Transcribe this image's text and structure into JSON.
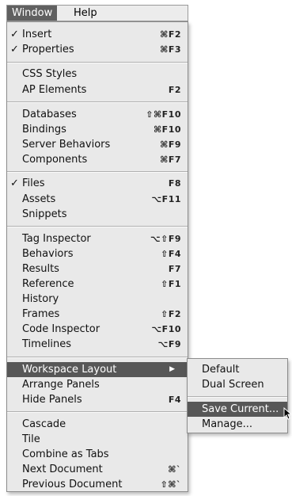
{
  "menubar": {
    "window_label": "Window",
    "help_label": "Help"
  },
  "menu": {
    "insert": {
      "check": "✓",
      "label": "Insert",
      "shortcut": "⌘F2"
    },
    "properties": {
      "check": "✓",
      "label": "Properties",
      "shortcut": "⌘F3"
    },
    "css_styles": {
      "label": "CSS Styles"
    },
    "ap_elements": {
      "label": "AP Elements",
      "shortcut": "F2"
    },
    "databases": {
      "label": "Databases",
      "shortcut": "⇧⌘F10"
    },
    "bindings": {
      "label": "Bindings",
      "shortcut": "⌘F10"
    },
    "server_behaviors": {
      "label": "Server Behaviors",
      "shortcut": "⌘F9"
    },
    "components": {
      "label": "Components",
      "shortcut": "⌘F7"
    },
    "files": {
      "check": "✓",
      "label": "Files",
      "shortcut": "F8"
    },
    "assets": {
      "label": "Assets",
      "shortcut": "⌥F11"
    },
    "snippets": {
      "label": "Snippets"
    },
    "tag_inspector": {
      "label": "Tag Inspector",
      "shortcut": "⌥⇧F9"
    },
    "behaviors": {
      "label": "Behaviors",
      "shortcut": "⇧F4"
    },
    "results": {
      "label": "Results",
      "shortcut": "F7"
    },
    "reference": {
      "label": "Reference",
      "shortcut": "⇧F1"
    },
    "history": {
      "label": "History"
    },
    "frames": {
      "label": "Frames",
      "shortcut": "⇧F2"
    },
    "code_inspector": {
      "label": "Code Inspector",
      "shortcut": "⌥F10"
    },
    "timelines": {
      "label": "Timelines",
      "shortcut": "⌥F9"
    },
    "workspace_layout": {
      "label": "Workspace Layout",
      "arrow": "▶"
    },
    "arrange_panels": {
      "label": "Arrange Panels"
    },
    "hide_panels": {
      "label": "Hide Panels",
      "shortcut": "F4"
    },
    "cascade": {
      "label": "Cascade"
    },
    "tile": {
      "label": "Tile"
    },
    "combine_as_tabs": {
      "label": "Combine as Tabs"
    },
    "next_document": {
      "label": "Next Document",
      "shortcut": "⌘`"
    },
    "previous_document": {
      "label": "Previous Document",
      "shortcut": "⇧⌘`"
    }
  },
  "submenu": {
    "default": "Default",
    "dual_screen": "Dual Screen",
    "save_current": "Save Current...",
    "manage": "Manage..."
  },
  "colors": {
    "highlight": "#575757",
    "menu_bg": "#e9e9e9"
  }
}
